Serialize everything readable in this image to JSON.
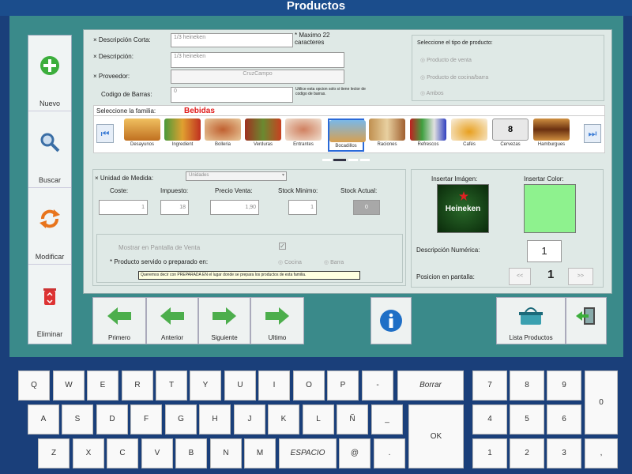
{
  "window": {
    "title": "Productos"
  },
  "leftbar": {
    "nuevo": "Nuevo",
    "buscar": "Buscar",
    "modificar": "Modificar",
    "eliminar": "Eliminar"
  },
  "form": {
    "desc_corta_label": "Descripción Corta:",
    "desc_corta_value": "1/3 heineken",
    "max_note": "* Maximo 22 caracteres",
    "desc_label": "Descripción:",
    "desc_value": "1/3 heineken",
    "proveedor_label": "Proveedor:",
    "proveedor_value": "CruzCampo",
    "barras_label": "Codigo de Barras:",
    "barras_value": "0",
    "barras_note": "Utilice esta opcion solo si tiene lector de codigo de barras."
  },
  "tipo": {
    "title": "Seleccione el tipo de producto:",
    "opt1": "Producto de venta",
    "opt2": "Producto de cocina/barra",
    "opt3": "Ambos"
  },
  "familia": {
    "label": "Seleccione la familia:",
    "selected": "Bebidas",
    "items": [
      "Desayunos",
      "Ingredient",
      "Bolleria",
      "Verduras",
      "Entrantes",
      "Bocadillos",
      "Raciones",
      "Refrescos",
      "Cafés",
      "Cervezas",
      "Hamburgues"
    ],
    "cervezas_badge": "8"
  },
  "medida": {
    "label": "Unidad de Medida:",
    "value": "Unidades",
    "coste_label": "Coste:",
    "coste_value": "1",
    "impuesto_label": "Impuesto:",
    "impuesto_value": "18",
    "precio_label": "Precio Venta:",
    "precio_value": "1,90",
    "stock_min_label": "Stock Minimo:",
    "stock_min_value": "1",
    "stock_act_label": "Stock Actual:",
    "stock_act_value": "0"
  },
  "servido": {
    "mostrar_label": "Mostrar en Pantalla de Venta",
    "prep_label": "* Producto servido o preparado en:",
    "cocina": "Cocina",
    "barra": "Barra",
    "tooltip": "Queremos decir con PREPARADA EN el lugar donde se prepara los productos de esta familia."
  },
  "imagen": {
    "img_label": "Insertar Imágen:",
    "color_label": "Insertar Color:",
    "heineken_text": "Heineken",
    "color": "#8ef28e",
    "desc_num_label": "Descripción Numérica:",
    "desc_num_value": "1",
    "pos_label": "Posicion en pantalla:",
    "pos_value": "1",
    "pos_prev": "<<",
    "pos_next": ">>"
  },
  "bottom": {
    "primero": "Primero",
    "anterior": "Anterior",
    "siguiente": "Siguiente",
    "ultimo": "Ultimo",
    "lista": "Lista Productos"
  },
  "keyboard": {
    "row1": [
      "Q",
      "W",
      "E",
      "R",
      "T",
      "Y",
      "U",
      "I",
      "O",
      "P",
      "-"
    ],
    "borrar": "Borrar",
    "row2": [
      "A",
      "S",
      "D",
      "F",
      "G",
      "H",
      "J",
      "K",
      "L",
      "Ñ",
      "_"
    ],
    "row3": [
      "Z",
      "X",
      "C",
      "V",
      "B",
      "N",
      "M"
    ],
    "espacio": "ESPACIO",
    "at": "@",
    "dot": ".",
    "ok": "OK",
    "numpad": [
      "7",
      "8",
      "9",
      "4",
      "5",
      "6",
      "1",
      "2",
      "3"
    ],
    "zero": "0",
    "comma": ","
  }
}
